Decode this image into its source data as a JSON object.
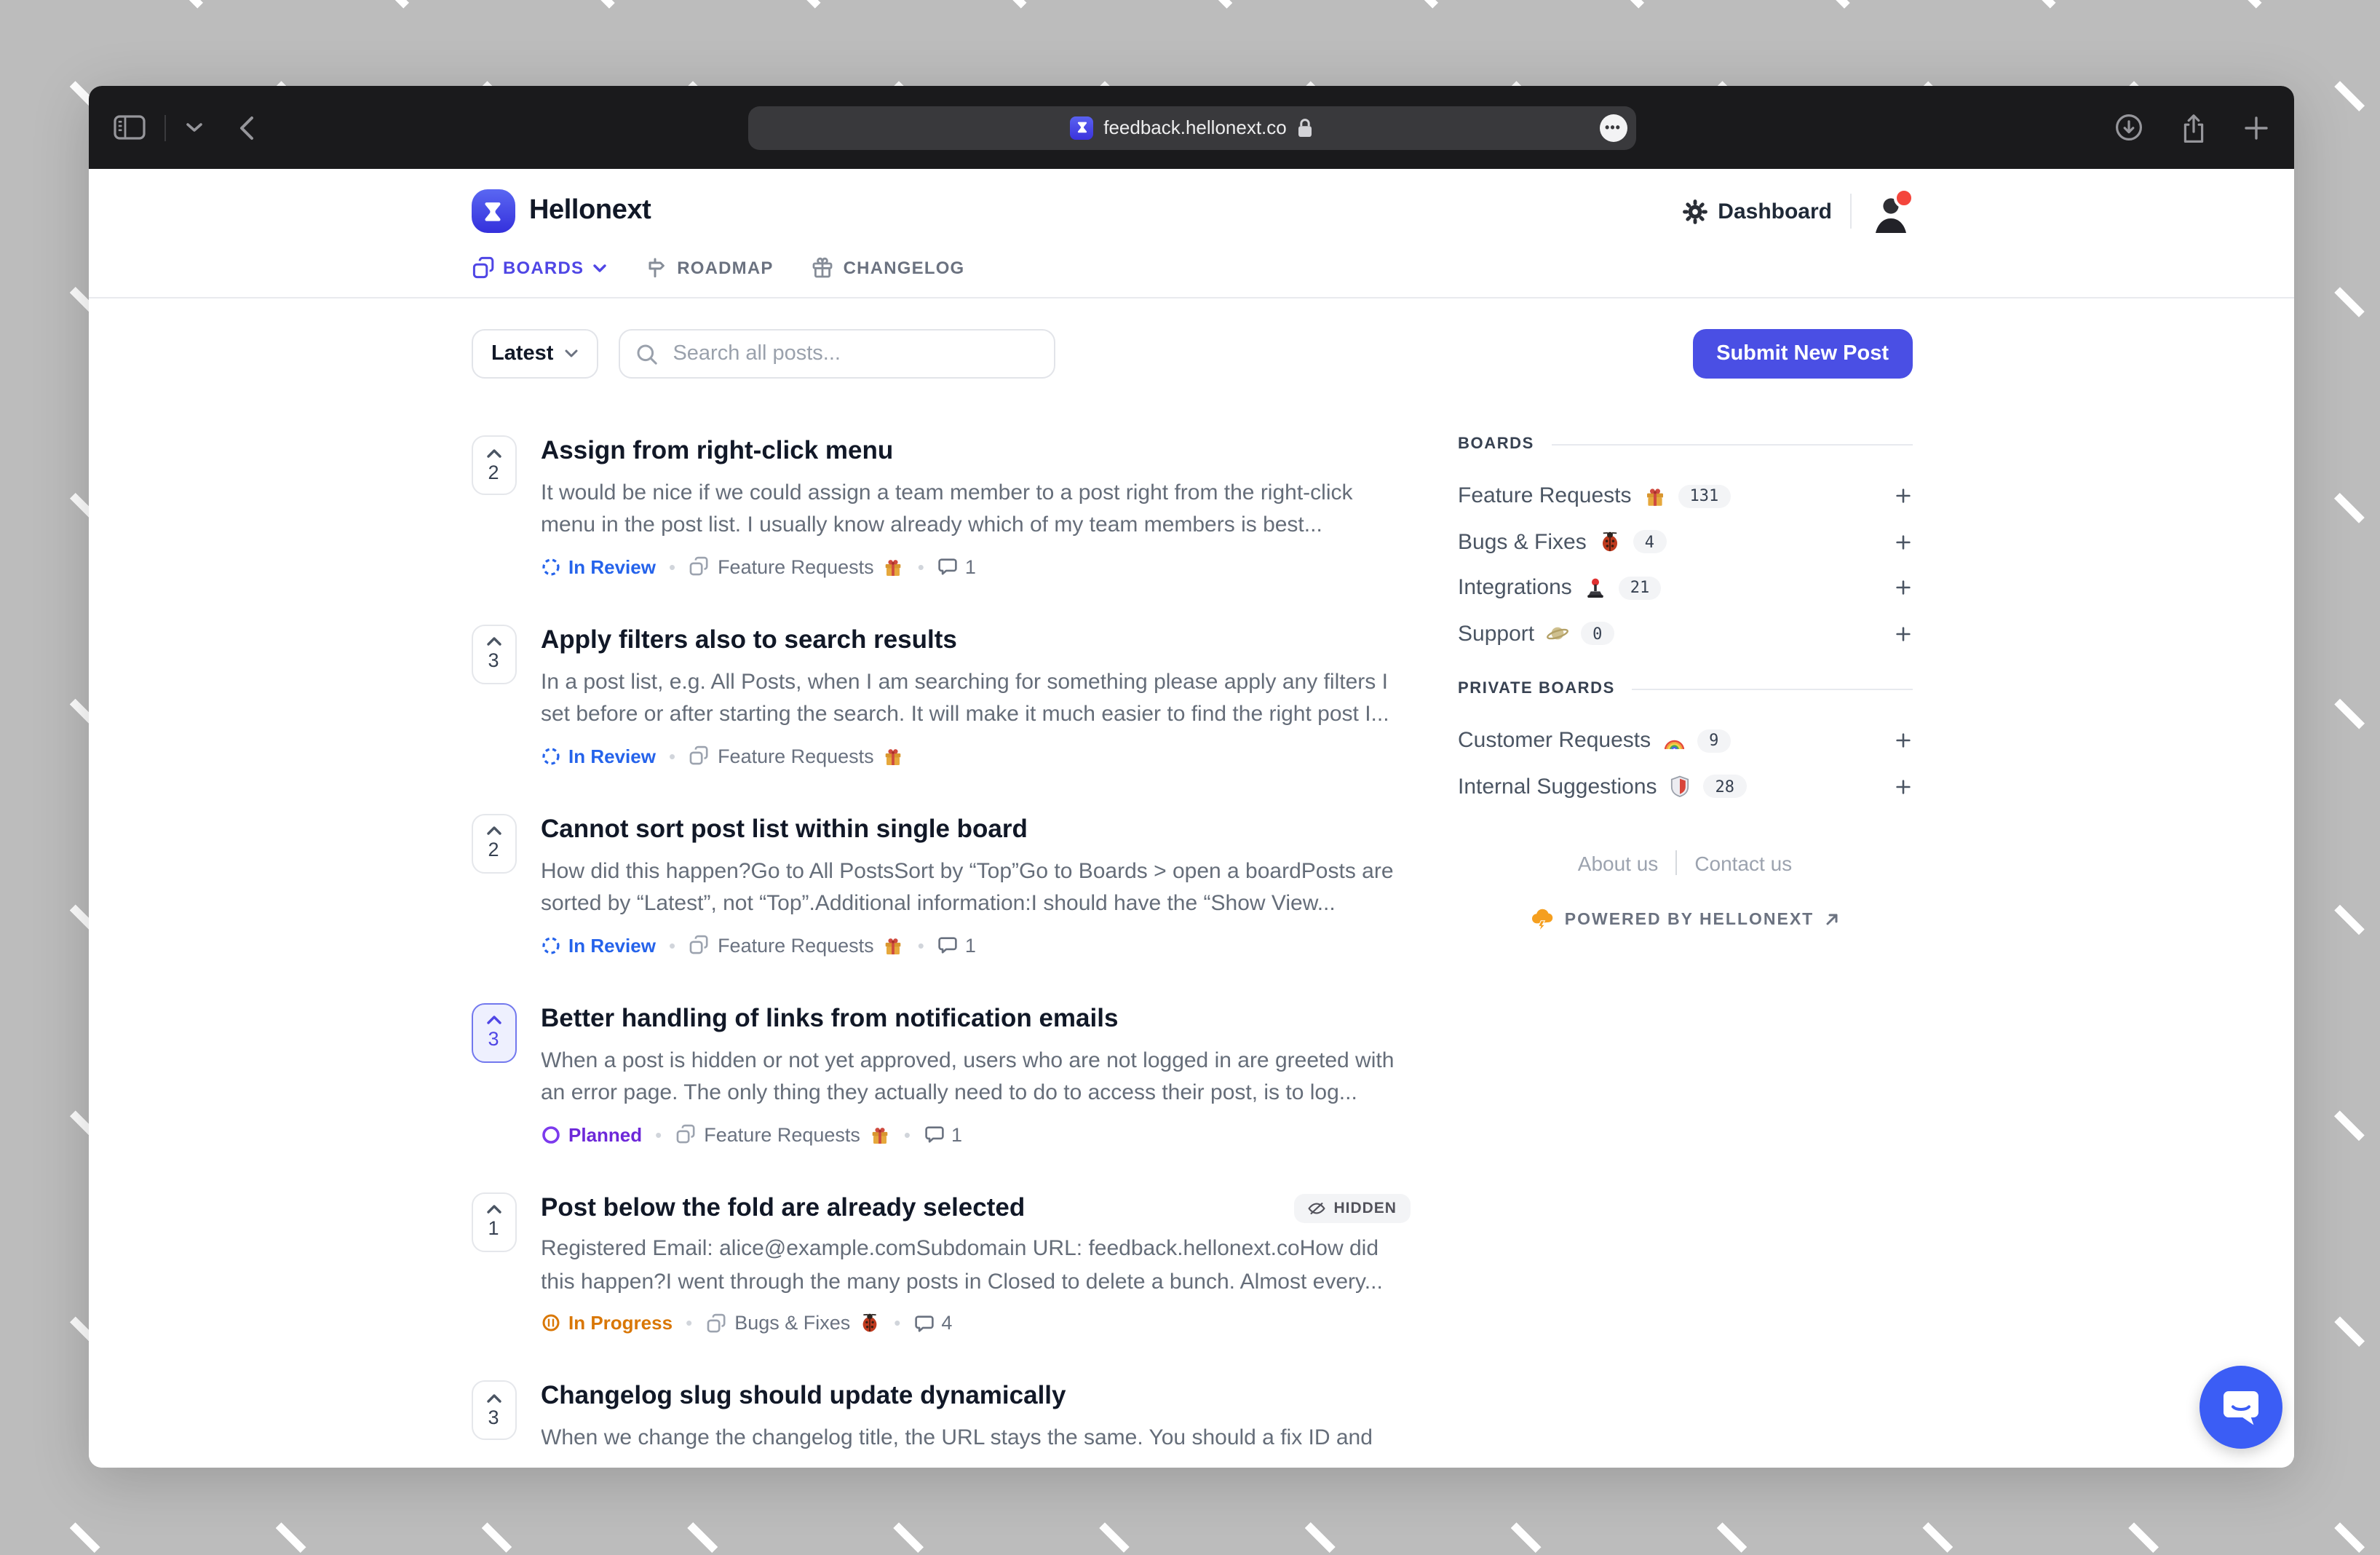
{
  "browser": {
    "url": "feedback.hellonext.co",
    "more_label": "•••"
  },
  "header": {
    "brand": "Hellonext",
    "dashboard_label": "Dashboard"
  },
  "nav": {
    "boards": "BOARDS",
    "roadmap": "ROADMAP",
    "changelog": "CHANGELOG"
  },
  "controls": {
    "sort_label": "Latest",
    "search_placeholder": "Search all posts...",
    "submit_label": "Submit New Post"
  },
  "posts": [
    {
      "votes": "2",
      "title": "Assign from right-click menu",
      "excerpt": "It would be nice if we could assign a team member to a post right from the right-click menu in the post list. I usually know already which of my team members is best...",
      "status": "In Review",
      "board": "Feature Requests",
      "board_emoji": "🎁",
      "comments": "1"
    },
    {
      "votes": "3",
      "title": "Apply filters also to search results",
      "excerpt": "In a post list, e.g. All Posts, when I am searching for something please apply any filters I set before or after starting the search. It will make it much easier to find the right post I...",
      "status": "In Review",
      "board": "Feature Requests",
      "board_emoji": "🎁"
    },
    {
      "votes": "2",
      "title": "Cannot sort post list within single board",
      "excerpt": "How did this happen?Go to All PostsSort by “Top”Go to Boards > open a boardPosts are sorted by “Latest”, not “Top”.Additional information:I should have the “Show View...",
      "status": "In Review",
      "board": "Feature Requests",
      "board_emoji": "🎁",
      "comments": "1"
    },
    {
      "votes": "3",
      "title": "Better handling of links from notification emails",
      "excerpt": "When a post is hidden or not yet approved, users who are not logged in are greeted with an error page. The only thing they actually need to do to access their post, is to log...",
      "status": "Planned",
      "board": "Feature Requests",
      "board_emoji": "🎁",
      "comments": "1",
      "selected": true
    },
    {
      "votes": "1",
      "title": "Post below the fold are already selected",
      "excerpt": "Registered Email: alice@example.comSubdomain URL: feedback.hellonext.coHow did this happen?I went through the many posts in Closed to delete a bunch. Almost every...",
      "status": "In Progress",
      "board": "Bugs & Fixes",
      "board_emoji": "🐞",
      "comments": "4",
      "badge": "HIDDEN"
    },
    {
      "votes": "3",
      "title": "Changelog slug should update dynamically",
      "excerpt": "When we change the changelog title, the URL stays the same. You should a fix ID and"
    }
  ],
  "sidebar": {
    "boards_heading": "BOARDS",
    "boards": [
      {
        "name": "Feature Requests",
        "emoji": "🎁",
        "count": "131"
      },
      {
        "name": "Bugs & Fixes",
        "emoji": "🐞",
        "count": "4"
      },
      {
        "name": "Integrations",
        "emoji": "🕹️",
        "count": "21"
      },
      {
        "name": "Support",
        "emoji": "🪐",
        "count": "0"
      }
    ],
    "private_heading": "PRIVATE BOARDS",
    "private_boards": [
      {
        "name": "Customer Requests",
        "emoji": "🌈",
        "count": "9"
      },
      {
        "name": "Internal Suggestions",
        "emoji": "🛡️",
        "count": "28"
      }
    ],
    "about_label": "About us",
    "contact_label": "Contact us",
    "powered_by": "POWERED BY HELLONEXT"
  },
  "colors": {
    "accent": "#4a4fe4",
    "nav_active": "#4f46e5",
    "in_review": "#2563eb",
    "planned": "#6d28d9",
    "in_progress": "#d97706",
    "titlebar": "#1a1a1c",
    "chat": "#3b5df5"
  }
}
